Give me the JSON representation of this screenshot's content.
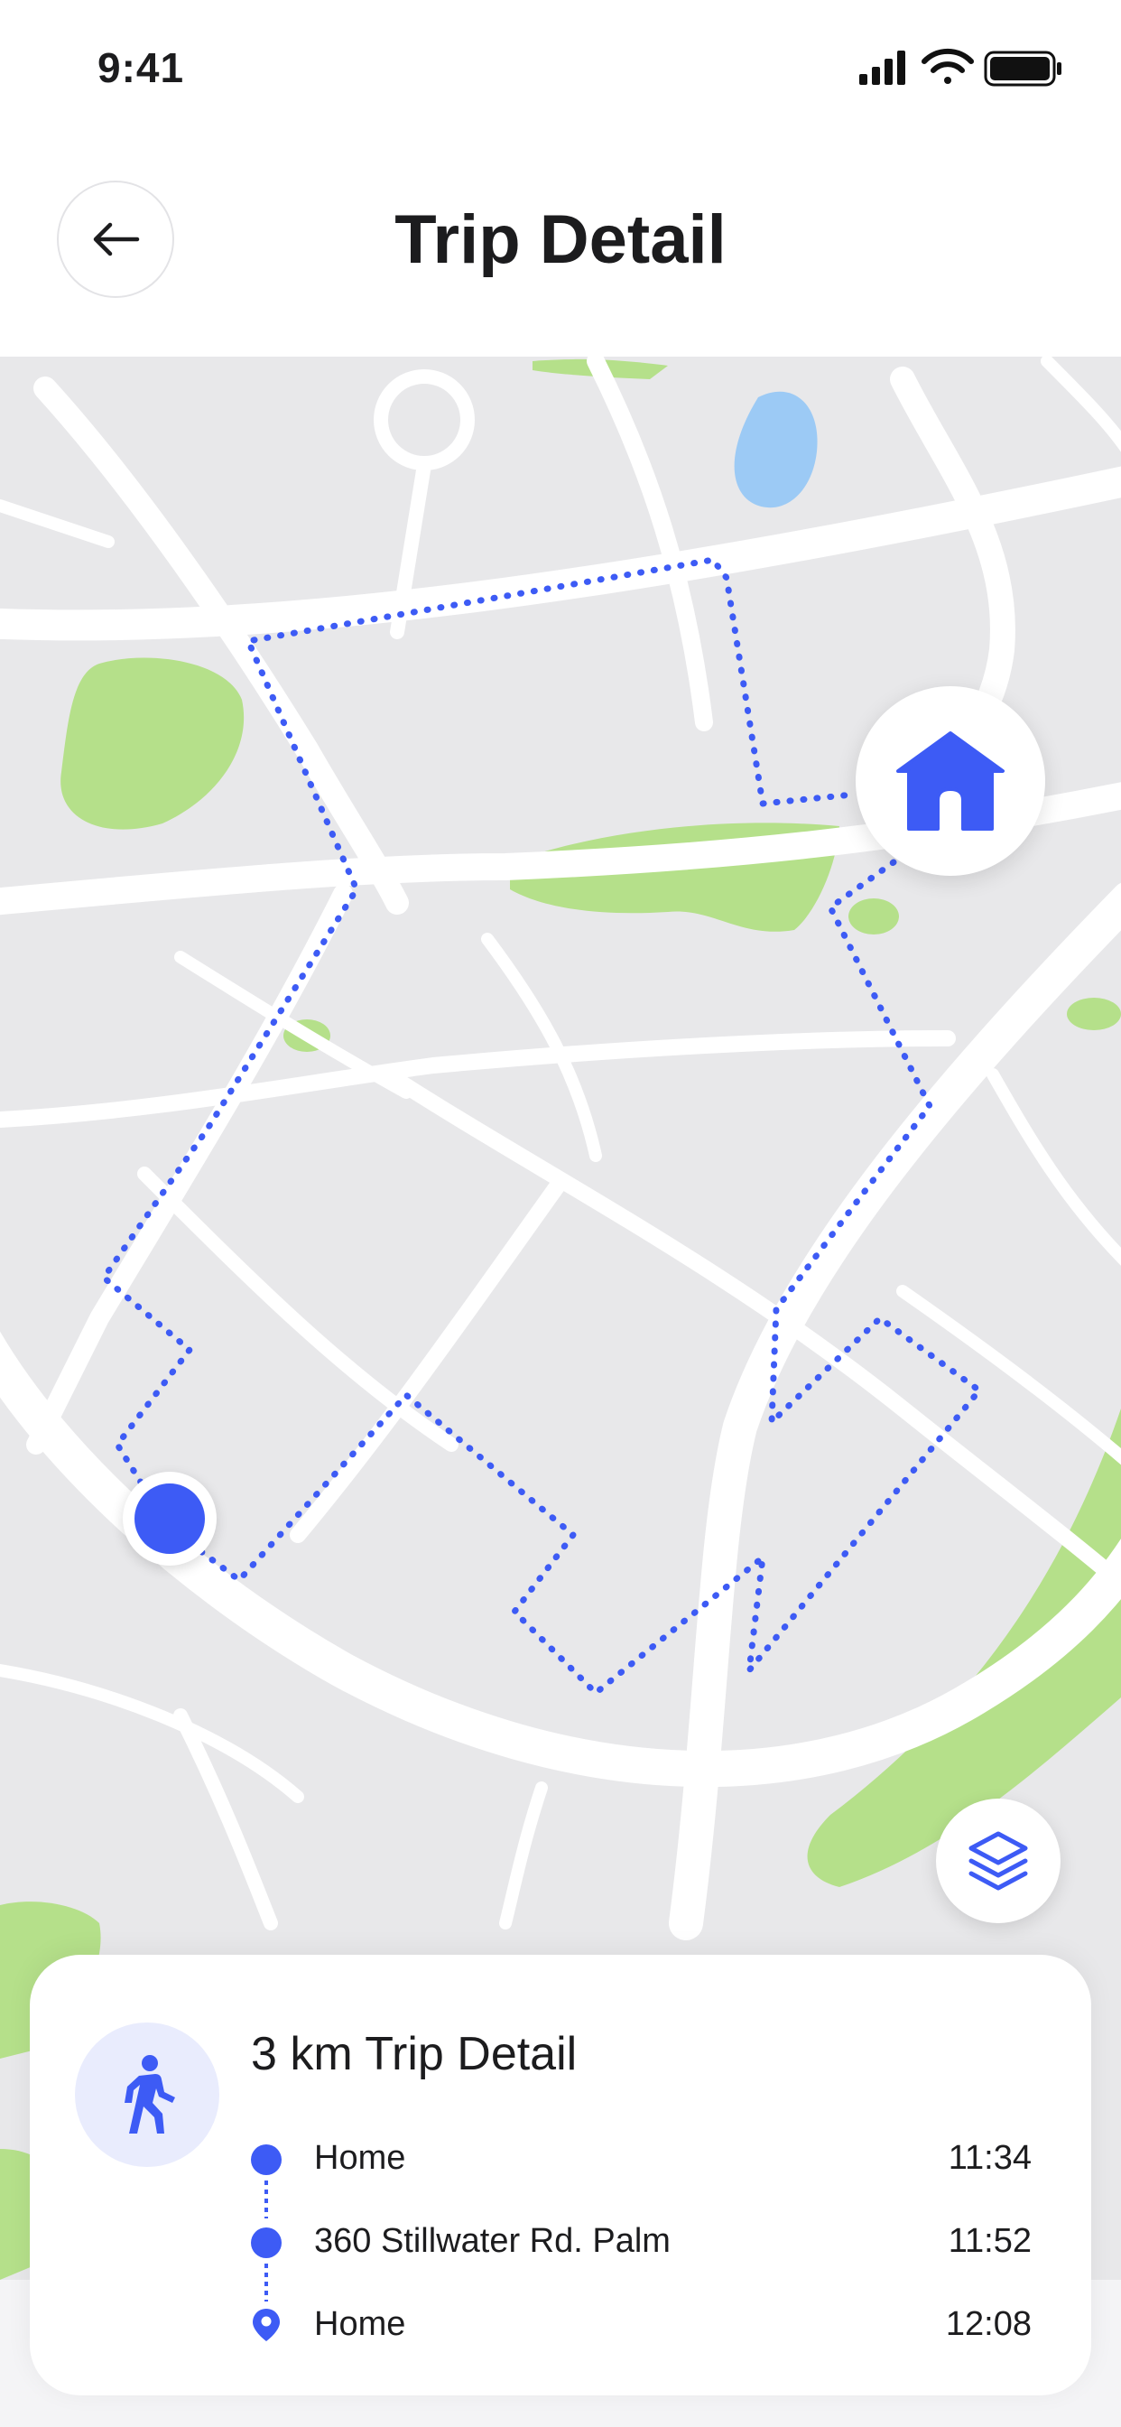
{
  "status_bar": {
    "time": "9:41"
  },
  "header": {
    "title": "Trip Detail"
  },
  "map": {
    "route_color": "#3d5bf5",
    "icons": [
      "home-icon",
      "user-location-icon",
      "layers-icon"
    ]
  },
  "trip": {
    "title": "3 km Trip Detail",
    "mode_icon": "walking-icon",
    "stops": [
      {
        "name": "Home",
        "time": "11:34"
      },
      {
        "name": "360 Stillwater Rd. Palm",
        "time": "11:52"
      },
      {
        "name": "Home",
        "time": "12:08"
      }
    ]
  },
  "colors": {
    "accent": "#3d5bf5",
    "park": "#b5e08a",
    "water": "#9ccaf5",
    "road": "#ffffff",
    "map_bg": "#e8e8ea"
  }
}
